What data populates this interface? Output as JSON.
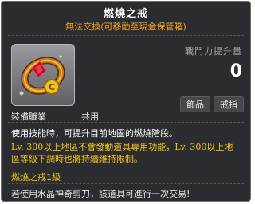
{
  "item": {
    "name": "燃燒之戒",
    "subtitle": "無法交換(可移動至現金保管箱)",
    "power_label": "戰鬥力提升量",
    "power_value": "0",
    "badges": [
      "飾品",
      "戒指"
    ],
    "job_label": "裝備職業",
    "job_value": "共用",
    "description": "使用技能時，可提升目前地圖的燃燒階段。",
    "note_line1": "Lv. 300以上地區不會發動道具專用功能，Lv. 300以上地",
    "note_line2": "區等級下調時也將持續維持限制。",
    "burn_level": "燃燒之戒1級",
    "trade_note": "若使用水晶神奇剪刀，該道具可進行一次交易!",
    "icon": "ring-icon"
  },
  "colors": {
    "panel_bg": "#2b2c30",
    "subtitle": "#f5a623",
    "highlight": "#f5c518"
  }
}
